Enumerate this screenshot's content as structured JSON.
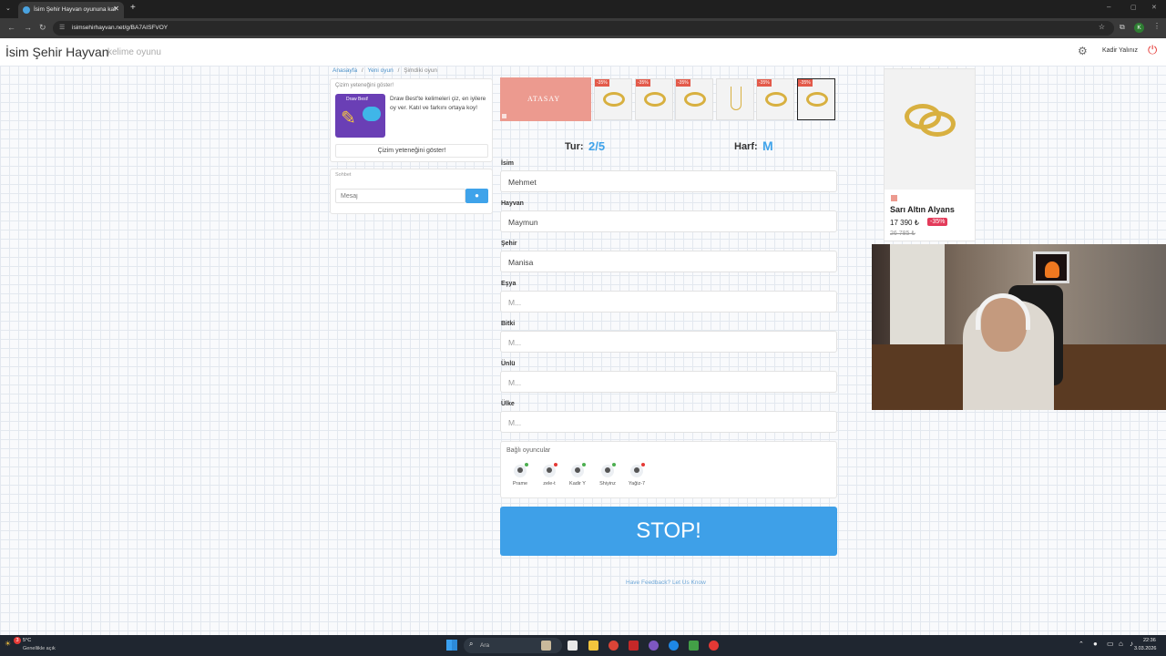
{
  "browser": {
    "tab_title": "İsim Şehir Hayvan oyununa kat",
    "url": "isimsehirhayvan.net/g/BA7AISFVOY",
    "profile_initial": "K"
  },
  "header": {
    "title": "İsim Şehir Hayvan",
    "subtitle": "kelime oyunu",
    "username": "Kadir Yalınız"
  },
  "breadcrumb": [
    "Anasayfa",
    "/",
    "Yeni oyun",
    "/",
    "Şimdiki oyun"
  ],
  "drawing_card": {
    "title": "Çizim yeteneğini göster!",
    "promo_label": "Draw Best!",
    "text": "Draw Best'te kelimeleri çiz, en iyilere oy ver. Katıl ve farkını ortaya koy!",
    "button": "Çizim yeteneğini göster!"
  },
  "chat": {
    "title": "Sohbet",
    "placeholder": "Mesaj"
  },
  "ad_strip": {
    "brand": "ATASAY",
    "discounts": [
      "-35%",
      "-35%",
      "-35%",
      "-35%",
      "-35%"
    ]
  },
  "round": {
    "tur_label": "Tur:",
    "tur_value": "2/5",
    "harf_label": "Harf:",
    "harf_value": "M"
  },
  "fields": [
    {
      "label": "İsim",
      "value": "Mehmet"
    },
    {
      "label": "Hayvan",
      "value": "Maymun"
    },
    {
      "label": "Şehir",
      "value": "Manisa"
    },
    {
      "label": "Eşya",
      "value": "M..."
    },
    {
      "label": "Bitki",
      "value": "M..."
    },
    {
      "label": "Ünlü",
      "value": "M..."
    },
    {
      "label": "Ülke",
      "value": "M..."
    }
  ],
  "players": {
    "title": "Bağlı oyuncular",
    "list": [
      {
        "name": "Prame"
      },
      {
        "name": "zele-t"
      },
      {
        "name": "Kadir Y"
      },
      {
        "name": "Shiyinz"
      },
      {
        "name": "Yağiz-7"
      }
    ]
  },
  "stop_button": "STOP!",
  "feedback": "Have Feedback? Let Us Know",
  "product_ad": {
    "name": "Sarı Altın Alyans",
    "price": "17 390 ₺",
    "discount": "-35%",
    "old_price": "26 785 ₺"
  },
  "taskbar": {
    "temp": "5°C",
    "weather": "Genellikle açık",
    "search": "Ara",
    "time": "22:36",
    "date": "3.03.2026",
    "badge": "3"
  },
  "colors": {
    "accent": "#3fa3ea",
    "stop": "#3ea0e8",
    "discount": "#e33b5a"
  }
}
